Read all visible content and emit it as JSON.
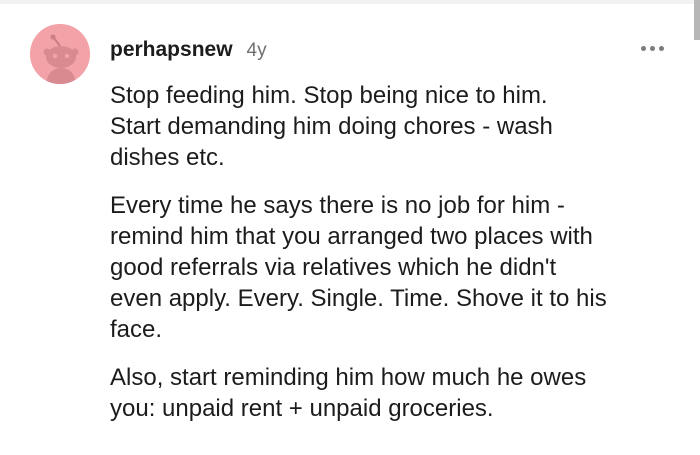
{
  "comment": {
    "author": "perhapsnew",
    "age": "4y",
    "paragraphs": [
      [
        "Stop feeding him. Stop being nice to him.",
        "Start demanding him doing chores - wash",
        "dishes etc."
      ],
      [
        "Every time he says there is no job for him -",
        "remind him that you arranged two places with",
        "good referrals via relatives which he didn't",
        "even apply. Every. Single. Time. Shove it to his",
        "face."
      ],
      [
        "Also, start reminding him how much he owes",
        "you: unpaid rent + unpaid groceries."
      ]
    ]
  },
  "icons": {
    "avatar": "reddit-snoo-avatar-icon",
    "more": "more-options-icon"
  },
  "colors": {
    "avatar_bg": "#f3a3a8",
    "text": "#1c1c1c",
    "meta": "#6f6f6f"
  }
}
